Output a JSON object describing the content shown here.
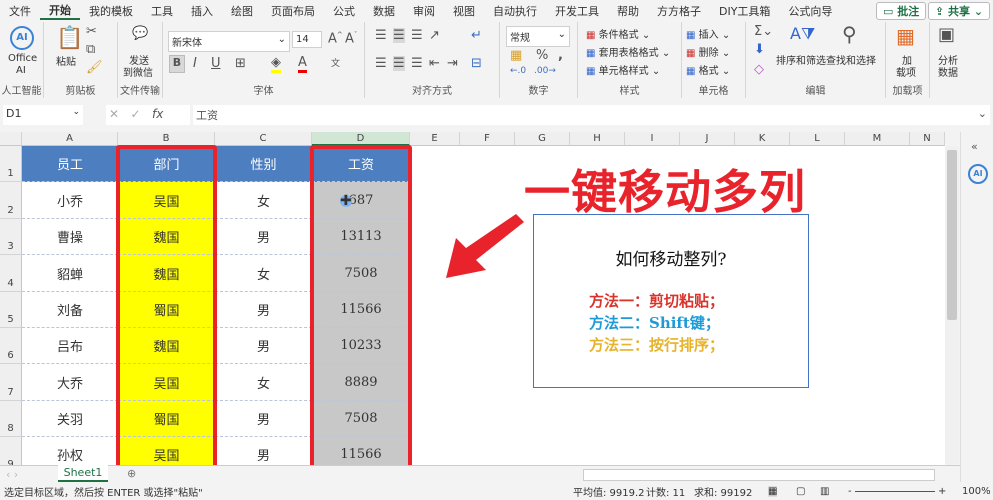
{
  "ribbon_tabs": [
    "文件",
    "开始",
    "我的模板",
    "工具",
    "插入",
    "绘图",
    "页面布局",
    "公式",
    "数据",
    "审阅",
    "视图",
    "自动执行",
    "开发工具",
    "帮助",
    "方方格子",
    "DIY工具箱",
    "公式向导"
  ],
  "active_tab": "开始",
  "comment_btn": "批注",
  "share_btn": "共享",
  "groups": {
    "ai": {
      "btn1": "Office",
      "btn2": "AI",
      "label": "人工智能"
    },
    "clipboard": {
      "paste": "粘贴",
      "label": "剪贴板"
    },
    "transfer": {
      "btn1": "发送",
      "btn2": "到微信",
      "label": "文件传输"
    },
    "font": {
      "name": "新宋体",
      "size": "14",
      "bold": "B",
      "italic": "I",
      "underline": "U",
      "label": "字体"
    },
    "align": {
      "label": "对齐方式"
    },
    "number": {
      "format": "常规",
      "label": "数字"
    },
    "styles": {
      "items": [
        "条件格式",
        "套用表格格式",
        "单元格样式"
      ],
      "label": "样式"
    },
    "cells": {
      "items": [
        "插入",
        "删除",
        "格式"
      ],
      "label": "单元格"
    },
    "edit": {
      "sort": "排序和筛选",
      "find": "查找和选择",
      "label": "编辑"
    },
    "addins": {
      "btn1": "加",
      "btn2": "载项",
      "label": "加载项"
    },
    "analyze": {
      "btn1": "分析",
      "btn2": "数据"
    }
  },
  "formula_bar": {
    "name_box": "D1",
    "fx": "fx",
    "value": "工资"
  },
  "columns": [
    "A",
    "B",
    "C",
    "D",
    "E",
    "F",
    "G",
    "H",
    "I",
    "J",
    "K",
    "L",
    "M",
    "N"
  ],
  "rows": [
    "1",
    "2",
    "3",
    "4",
    "5",
    "6",
    "7",
    "8",
    "9"
  ],
  "table": {
    "headers": [
      "员工",
      "部门",
      "性别",
      "工资"
    ],
    "data": [
      [
        "小乔",
        "吴国",
        "女",
        "687"
      ],
      [
        "曹操",
        "魏国",
        "男",
        "13113"
      ],
      [
        "貂蝉",
        "魏国",
        "女",
        "7508"
      ],
      [
        "刘备",
        "蜀国",
        "男",
        "11566"
      ],
      [
        "吕布",
        "魏国",
        "男",
        "10233"
      ],
      [
        "大乔",
        "吴国",
        "女",
        "8889"
      ],
      [
        "关羽",
        "蜀国",
        "男",
        "7508"
      ],
      [
        "孙权",
        "吴国",
        "男",
        "11566"
      ]
    ]
  },
  "colors": {
    "header_bg": "#4d7ebf",
    "dept_bg": "#ffff00",
    "salary_bg": "#c8c8c8",
    "highlight": "#e8232b"
  },
  "overlay_title": "一键移动多列",
  "textbox": {
    "title": "如何移动整列?",
    "methods": [
      {
        "text": "方法一：剪切粘贴；",
        "color": "#d9342b"
      },
      {
        "text": "方法二：Shift键；",
        "color": "#1e9bd7"
      },
      {
        "text": "方法三：按行排序；",
        "color": "#e6b32a"
      }
    ]
  },
  "sheet_tab": "Sheet1",
  "status": {
    "message": "选定目标区域，然后按 ENTER 或选择\"粘贴\"",
    "average": "平均值: 9919.2",
    "count": "计数: 11",
    "sum": "求和: 99192",
    "zoom": "100%"
  }
}
